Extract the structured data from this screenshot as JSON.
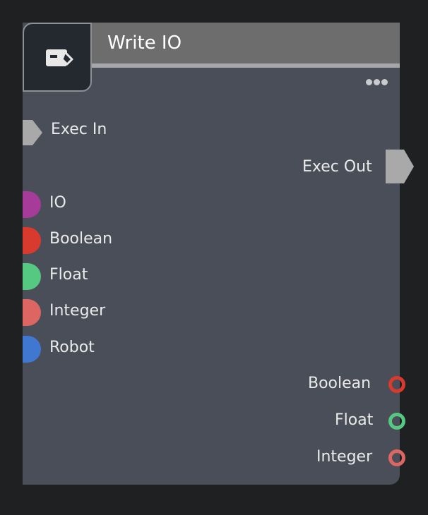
{
  "node": {
    "title": "Write IO",
    "icon": "write-node-icon",
    "more_icon": "more-dots-icon"
  },
  "exec": {
    "in_label": "Exec In",
    "out_label": "Exec Out",
    "pin_color": "#a9a9a9"
  },
  "inputs": [
    {
      "label": "IO",
      "color": "#a63b9a"
    },
    {
      "label": "Boolean",
      "color": "#d83a2d"
    },
    {
      "label": "Float",
      "color": "#55c982"
    },
    {
      "label": "Integer",
      "color": "#dd6662"
    },
    {
      "label": "Robot",
      "color": "#4077d0"
    }
  ],
  "outputs": [
    {
      "label": "Boolean",
      "color": "#d83a2d"
    },
    {
      "label": "Float",
      "color": "#55c982"
    },
    {
      "label": "Integer",
      "color": "#dd6662"
    }
  ]
}
